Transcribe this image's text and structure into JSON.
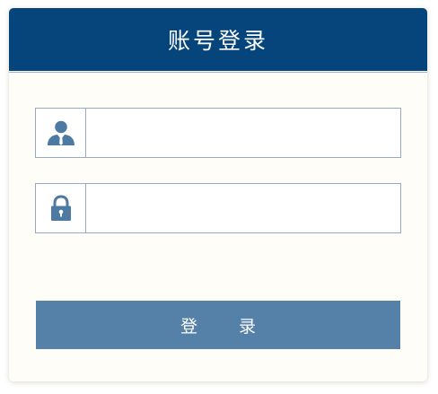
{
  "header": {
    "title": "账号登录"
  },
  "form": {
    "username": {
      "icon": "user-icon",
      "value": "",
      "placeholder": ""
    },
    "password": {
      "icon": "lock-icon",
      "value": "",
      "placeholder": ""
    },
    "submit_label": "登 录"
  },
  "colors": {
    "header_bg": "#06457c",
    "card_bg": "#fefdf7",
    "icon": "#4d7aa3",
    "button_bg": "#5580a8",
    "field_border": "#97aabd"
  }
}
